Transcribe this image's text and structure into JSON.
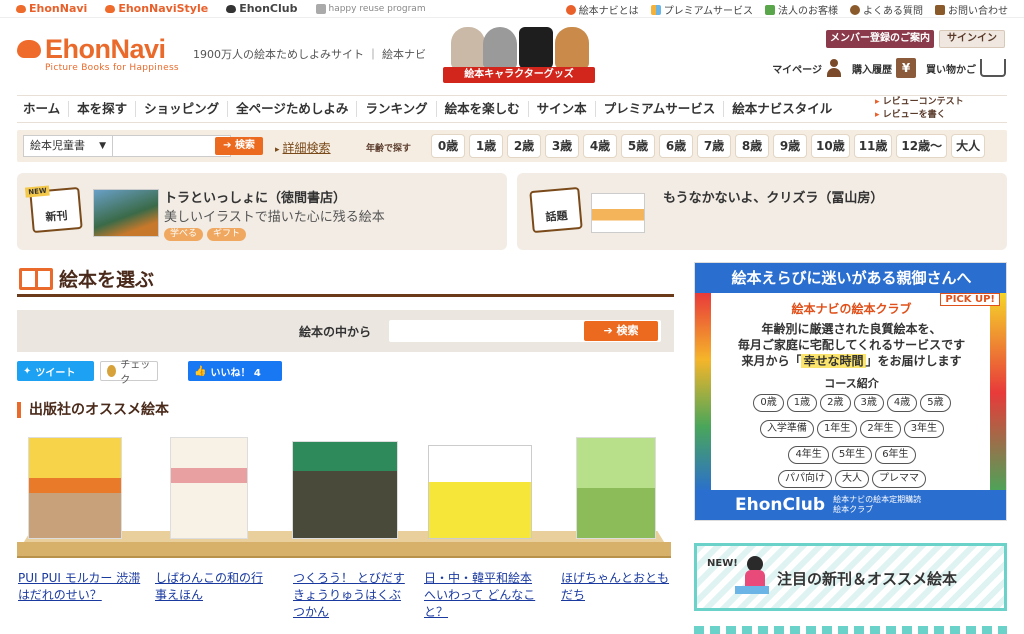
{
  "topbar": {
    "brands": [
      "EhonNavi",
      "EhonNaviStyle",
      "EhonClub",
      "happy reuse program"
    ],
    "links": [
      "絵本ナビとは",
      "プレミアムサービス",
      "法人のお客様",
      "よくある質問",
      "お問い合わせ"
    ]
  },
  "header": {
    "logo_text": "EhonNavi",
    "logo_sub": "Picture Books for Happiness",
    "tagline": "1900万人の絵本ためしよみサイト ｜ 絵本ナビ",
    "char_banner": "絵本キャラクターグッズ",
    "member_btn": "メンバー登録のご案内",
    "signin_btn": "サインイン",
    "mypage": "マイページ",
    "history": "購入履歴",
    "cart": "買い物かご",
    "yen_symbol": "¥"
  },
  "nav": {
    "items": [
      "ホーム",
      "本を探す",
      "ショッピング",
      "全ページためしよみ",
      "ランキング",
      "絵本を楽しむ",
      "サイン本",
      "プレミアムサービス",
      "絵本ナビスタイル"
    ],
    "side": [
      "レビューコンテスト",
      "レビューを書く"
    ]
  },
  "search": {
    "category": "絵本児童書",
    "button": "検索",
    "advanced": "詳細検索",
    "age_label": "年齢で探す",
    "ages": [
      "0歳",
      "1歳",
      "2歳",
      "3歳",
      "4歳",
      "5歳",
      "6歳",
      "7歳",
      "8歳",
      "9歳",
      "10歳",
      "11歳",
      "12歳〜",
      "大人"
    ]
  },
  "features": [
    {
      "badge": "新刊",
      "badge_tag": "NEW",
      "title": "トラといっしょに（徳間書店）",
      "desc": "美しいイラストで描いた心に残る絵本",
      "tags": [
        "学べる",
        "ギフト"
      ]
    },
    {
      "badge": "話題",
      "title": "もうなかないよ、クリズラ（冨山房）"
    }
  ],
  "main": {
    "heading": "絵本を選ぶ",
    "search_label": "絵本の中から",
    "search_btn": "検索",
    "tweet": "ツイート",
    "check": "チェック",
    "like": "いいね！ 4",
    "recommend_heading": "出版社のオススメ絵本"
  },
  "books": [
    {
      "title": "PUI PUI モルカー 渋滞はだれのせい？",
      "color": "#f2c230"
    },
    {
      "title": "しばわんこの和の行事えほん",
      "color": "#f4ede0"
    },
    {
      "title": "つくろう！ とびだす きょうりゅうはくぶつかん",
      "color": "#2e8a5a"
    },
    {
      "title": "日・中・韓平和絵本 へいわって どんなこと？",
      "color": "#f6e63a"
    },
    {
      "title": "ほげちゃんとおともだち",
      "color": "#a7d66a"
    }
  ],
  "ad": {
    "head": "絵本えらびに迷いがある親御さんへ",
    "sub": "絵本ナビの絵本クラブ",
    "pick": "PICK UP!",
    "lines": [
      "年齢別に厳選された良質絵本を、",
      "毎月ご家庭に宅配してくれるサービスです"
    ],
    "line3_pre": "来月から「",
    "line3_hl": "幸せな時間",
    "line3_post": "」をお届けします",
    "course": "コース紹介",
    "pills_row1": [
      "0歳",
      "1歳",
      "2歳",
      "3歳",
      "4歳",
      "5歳"
    ],
    "pills_row2": [
      "入学準備",
      "1年生",
      "2年生",
      "3年生"
    ],
    "pills_row3": [
      "4年生",
      "5年生",
      "6年生"
    ],
    "pills_row4": [
      "パパ向け",
      "大人",
      "プレママ"
    ],
    "foot_brand": "EhonClub",
    "foot_desc1": "絵本ナビの絵本定期購読",
    "foot_desc2": "絵本クラブ"
  },
  "newbox": {
    "new": "NEW!",
    "text": "注目の新刊＆オススメ絵本"
  }
}
